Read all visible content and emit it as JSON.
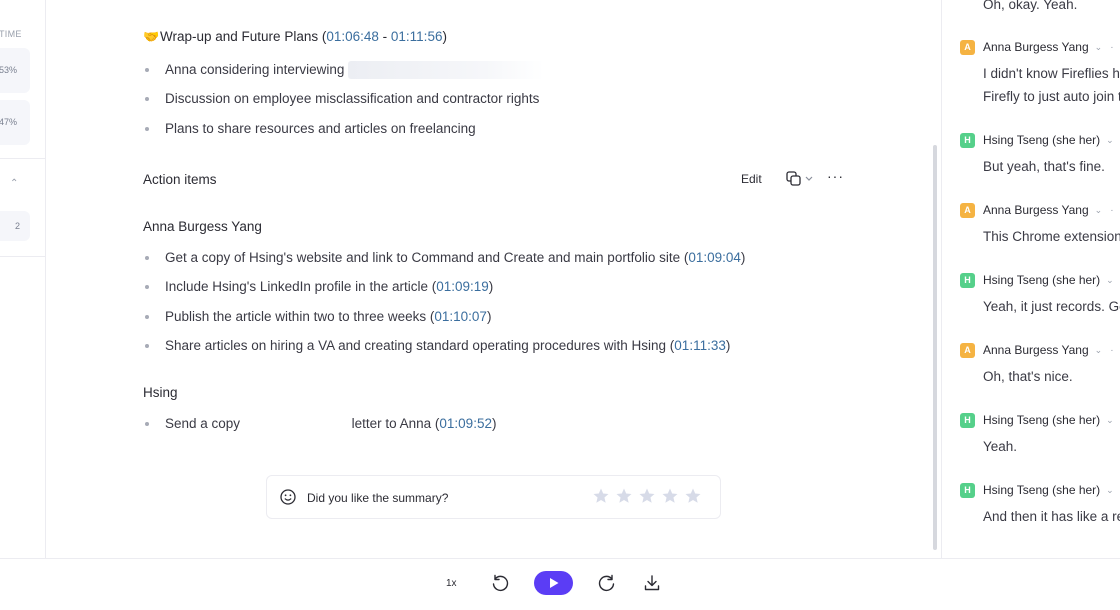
{
  "left_panel": {
    "time_label": "TIME",
    "stats": [
      "53%",
      "47%"
    ],
    "count": "2"
  },
  "summary": {
    "section_emoji": "🤝",
    "section_title": "Wrap-up and Future Plans",
    "time_start": "01:06:48",
    "time_end": "01:11:56",
    "bullets": [
      "Anna considering interviewing",
      "Discussion on employee misclassification and contractor rights",
      "Plans to share resources and articles on freelancing"
    ]
  },
  "action_items": {
    "header": "Action items",
    "edit_label": "Edit",
    "groups": [
      {
        "person": "Anna Burgess Yang",
        "items": [
          {
            "text": "Get a copy of Hsing's website and link to Command and Create and main portfolio site",
            "time": "01:09:04"
          },
          {
            "text": "Include Hsing's LinkedIn profile in the article",
            "time": "01:09:19"
          },
          {
            "text": "Publish the article within two to three weeks",
            "time": "01:10:07"
          },
          {
            "text": "Share articles on hiring a VA and creating standard operating procedures with Hsing",
            "time": "01:11:33"
          }
        ]
      },
      {
        "person": "Hsing",
        "items": [
          {
            "text_start": "Send a copy",
            "text_end": "letter to Anna",
            "time": "01:09:52"
          }
        ]
      }
    ]
  },
  "feedback": {
    "question": "Did you like the summary?",
    "rating": 0,
    "max_rating": 5,
    "icon": "smile-icon"
  },
  "transcript": {
    "top_line": "Oh, okay. Yeah.",
    "entries": [
      {
        "initial": "A",
        "speaker": "Anna Burgess Yang",
        "lines": [
          "I didn't know Fireflies h",
          "Firefly to just auto join t"
        ]
      },
      {
        "initial": "H",
        "speaker": "Hsing Tseng (she her)",
        "lines": [
          "But yeah, that's fine."
        ]
      },
      {
        "initial": "A",
        "speaker": "Anna Burgess Yang",
        "lines": [
          "This Chrome extension"
        ]
      },
      {
        "initial": "H",
        "speaker": "Hsing Tseng (she her)",
        "lines": [
          "Yeah, it just records. Go"
        ]
      },
      {
        "initial": "A",
        "speaker": "Anna Burgess Yang",
        "lines": [
          "Oh, that's nice."
        ]
      },
      {
        "initial": "H",
        "speaker": "Hsing Tseng (she her)",
        "lines": [
          "Yeah."
        ]
      },
      {
        "initial": "H",
        "speaker": "Hsing Tseng (she her)",
        "lines": [
          "And then it has like a re"
        ]
      }
    ]
  },
  "player": {
    "speed": "1x",
    "accent_color": "#5b3df5"
  }
}
